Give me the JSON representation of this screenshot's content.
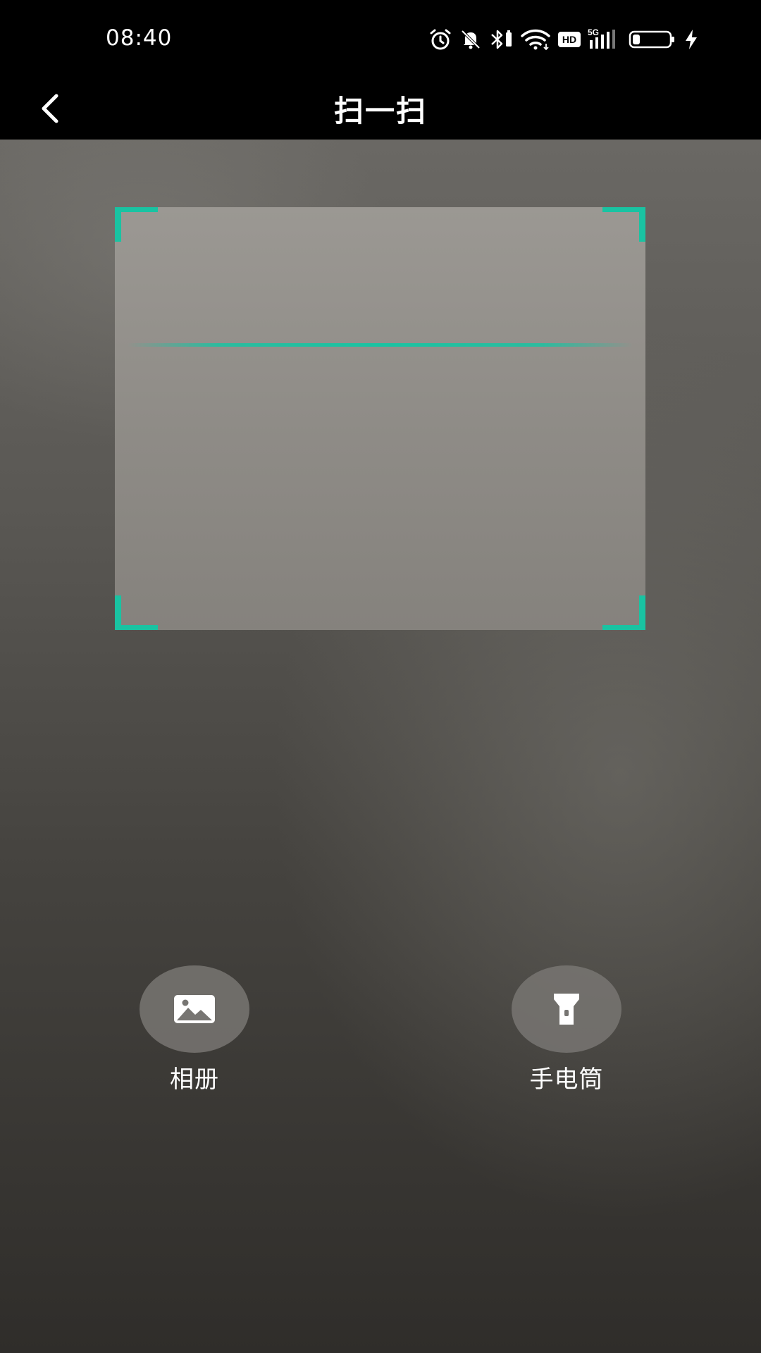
{
  "status_bar": {
    "time": "08:40",
    "icons": [
      "alarm-icon",
      "bell-off-icon",
      "bluetooth-icon",
      "wifi-icon",
      "hd-icon",
      "signal-5g-icon",
      "battery-icon",
      "charging-icon"
    ],
    "hd_label": "HD",
    "network_label": "5G"
  },
  "nav": {
    "title": "扫一扫",
    "back_icon": "chevron-left-icon"
  },
  "scanner": {
    "accent_color": "#19c3a2"
  },
  "actions": {
    "album_label": "相册",
    "album_icon": "image-icon",
    "torch_label": "手电筒",
    "torch_icon": "flashlight-icon"
  }
}
